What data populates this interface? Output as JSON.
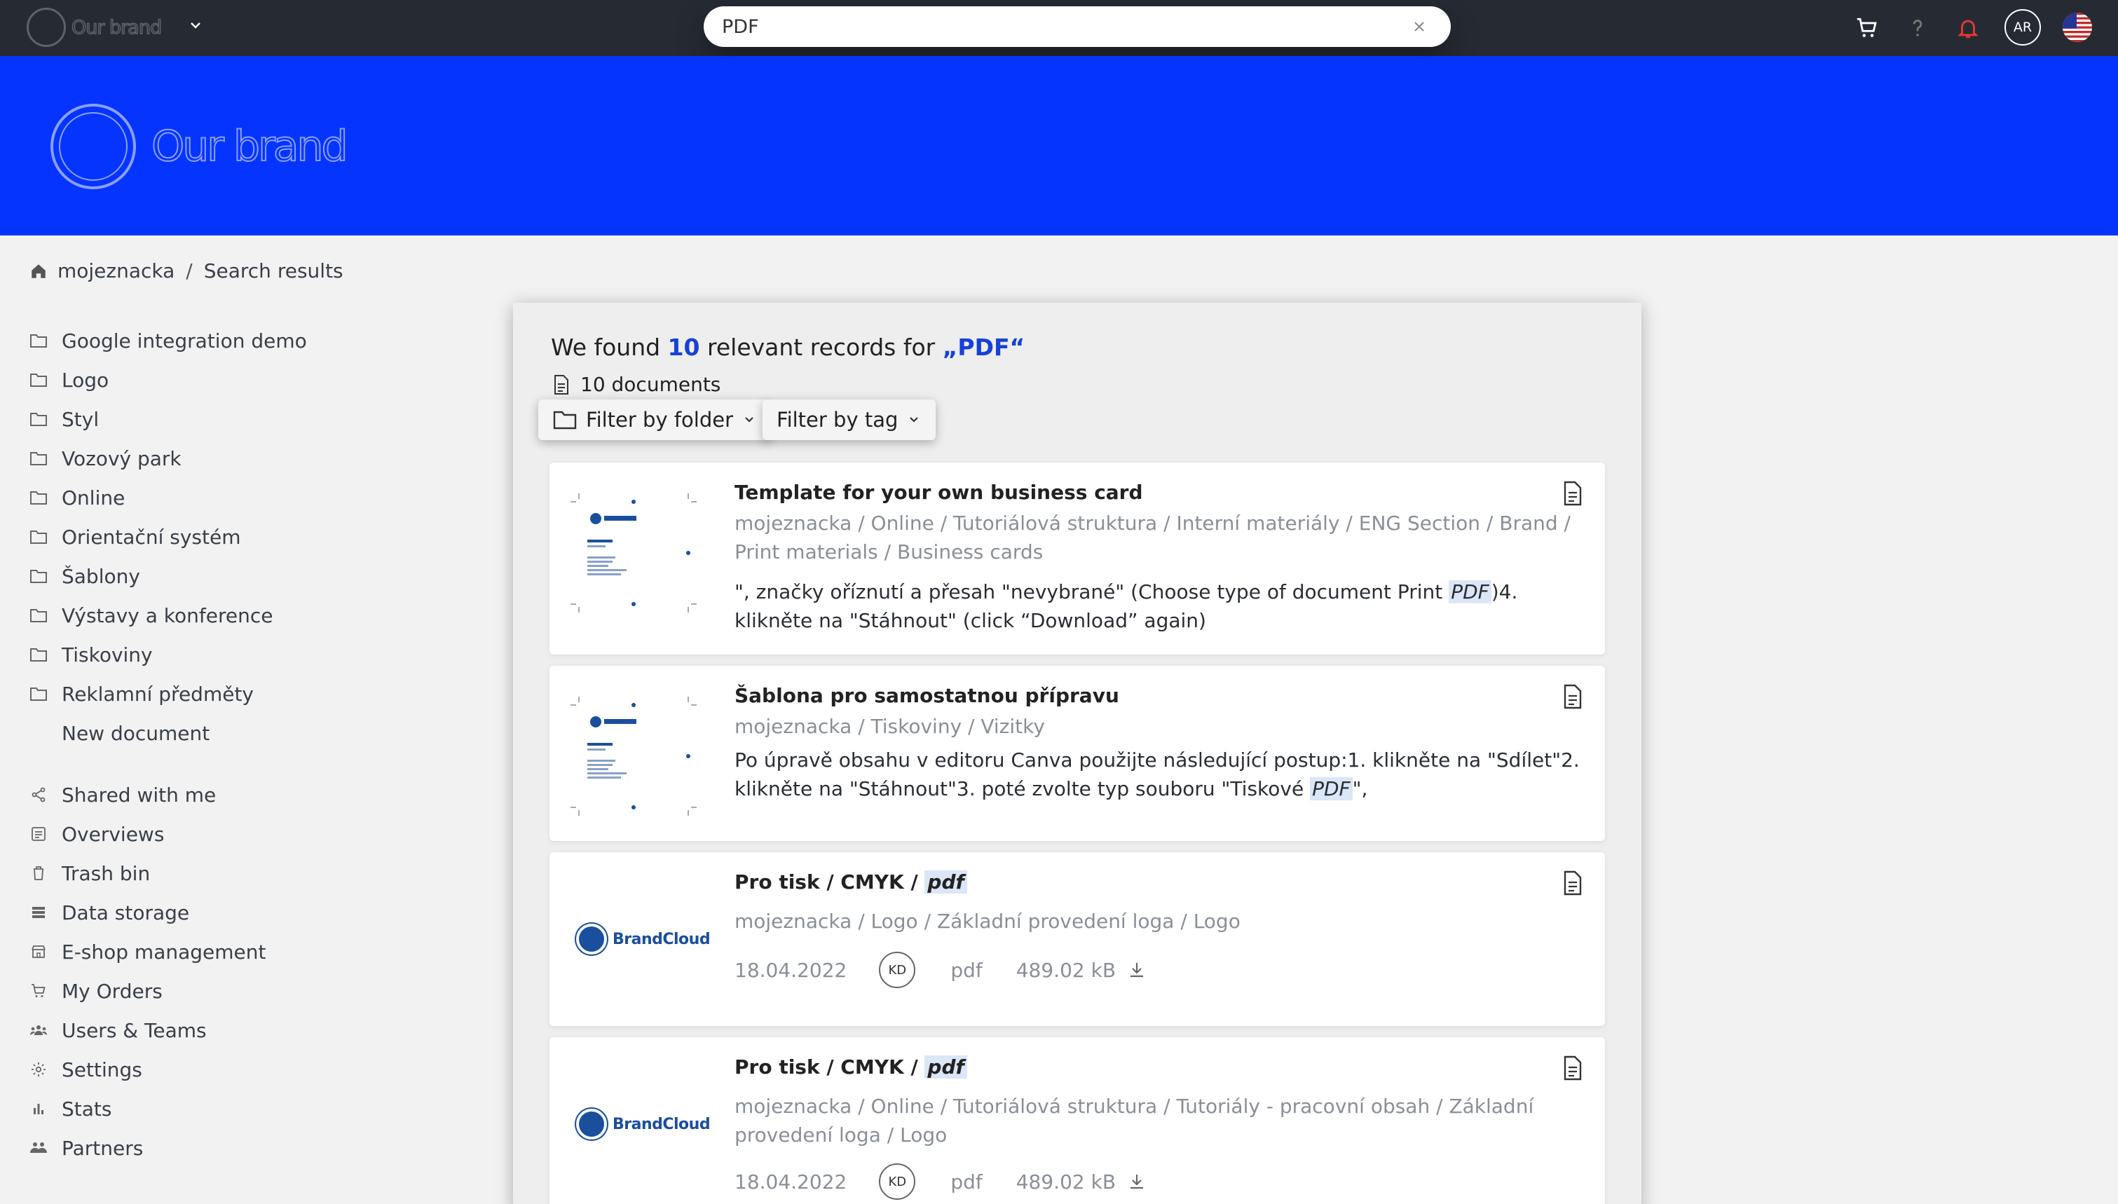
{
  "header": {
    "brand_name": "Our brand",
    "search_value": "PDF",
    "avatar_initials": "AR",
    "icons": [
      "cart-icon",
      "help-icon",
      "bell-icon",
      "avatar",
      "us-flag-icon"
    ]
  },
  "banner": {
    "brand_name": "Our brand",
    "color": "#0534ff"
  },
  "breadcrumb": {
    "home": "mojeznacka",
    "current": "Search results"
  },
  "sidebar": {
    "folders": [
      {
        "label": "Google integration demo"
      },
      {
        "label": "Logo"
      },
      {
        "label": "Styl"
      },
      {
        "label": "Vozový park"
      },
      {
        "label": "Online"
      },
      {
        "label": "Orientační systém"
      },
      {
        "label": "Šablony"
      },
      {
        "label": "Výstavy a konference"
      },
      {
        "label": "Tiskoviny"
      },
      {
        "label": "Reklamní předměty"
      }
    ],
    "new_document": "New document",
    "nav": [
      {
        "label": "Shared with me",
        "icon": "share-icon"
      },
      {
        "label": "Overviews",
        "icon": "overview-icon"
      },
      {
        "label": "Trash bin",
        "icon": "trash-icon"
      },
      {
        "label": "Data storage",
        "icon": "storage-icon"
      },
      {
        "label": "E-shop management",
        "icon": "shop-icon"
      },
      {
        "label": "My Orders",
        "icon": "cart-icon"
      },
      {
        "label": "Users & Teams",
        "icon": "users-icon"
      },
      {
        "label": "Settings",
        "icon": "gear-icon"
      },
      {
        "label": "Stats",
        "icon": "stats-icon"
      },
      {
        "label": "Partners",
        "icon": "partners-icon"
      }
    ]
  },
  "results": {
    "found_prefix": "We found",
    "found_count": "10",
    "found_middle": "relevant records for",
    "query": "„PDF“",
    "doc_count": "10 documents",
    "filter_folder": "Filter by folder",
    "filter_tag": "Filter by tag",
    "items": [
      {
        "title": "Template for your own business card",
        "path": "mojeznacka / Online / Tutoriálová struktura / Interní materiály / ENG Section / Brand / Print materials / Business cards",
        "snippet_before": "\", značky oříznutí a přesah \"nevybrané\" (Choose type of document Print ",
        "snippet_hl": "PDF",
        "snippet_after": ")4. klikněte na \"Stáhnout\" (click “Download” again)"
      },
      {
        "title": "Šablona pro samostatnou přípravu",
        "path": "mojeznacka / Tiskoviny / Vizitky",
        "snippet_before": "Po úpravě obsahu v editoru Canva použijte následující postup:1. klikněte na \"Sdílet\"2. klikněte na \"Stáhnout\"3. poté zvolte typ souboru \"Tiskové ",
        "snippet_hl": "PDF",
        "snippet_after": "\","
      },
      {
        "title_prefix": "Pro tisk / CMYK / ",
        "title_hl": "pdf",
        "path": "mojeznacka / Logo / Základní provedení loga / Logo",
        "date": "18.04.2022",
        "author": "KD",
        "filetype": "pdf",
        "size": "489.02 kB",
        "thumb_label": "BrandCloud"
      },
      {
        "title_prefix": "Pro tisk / CMYK / ",
        "title_hl": "pdf",
        "path": "mojeznacka / Online / Tutoriálová struktura / Tutoriály - pracovní obsah / Základní provedení loga / Logo",
        "date": "18.04.2022",
        "author": "KD",
        "filetype": "pdf",
        "size": "489.02 kB",
        "thumb_label": "BrandCloud"
      }
    ]
  },
  "colors": {
    "topbar": "#262b33",
    "accent": "#1641d9",
    "highlight": "#dbe6f7",
    "notification": "#e53935"
  }
}
